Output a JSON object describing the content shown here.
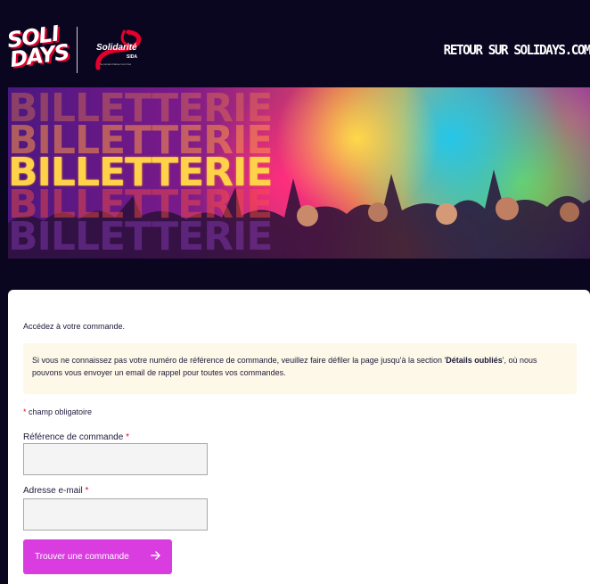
{
  "header": {
    "logo_soli_line1": "SOLI",
    "logo_soli_line2": "DAYS",
    "logo_sida_name": "Solidarité",
    "logo_sida_sub": "SIDA",
    "logo_sida_tagline": "Ne jamais baisser les bras",
    "retour_label": "RETOUR SUR SOLIDAYS.COM"
  },
  "banner": {
    "word": "BILLETTERIE"
  },
  "form": {
    "intro": "Accédez à votre commande.",
    "notice_before": "Si vous ne connaissez pas votre numéro de référence de commande, veuillez faire défiler la page jusqu'à la section '",
    "notice_bold": "Détails oubliés",
    "notice_after": "', où nous pouvons vous envoyer un email de rappel pour toutes vos commandes.",
    "required_star": "*",
    "required_note": " champ obligatoire",
    "ref_label": "Référence de commande",
    "ref_value": "",
    "email_label": "Adresse e-mail",
    "email_value": "",
    "submit_label": "Trouver une commande"
  },
  "colors": {
    "header_bg": "#0b0620",
    "button_bg": "#d93de0",
    "required_star": "#e4002b",
    "notice_bg": "#fdf8e8"
  },
  "icons": {
    "submit_icon": "arrow-right-icon"
  }
}
